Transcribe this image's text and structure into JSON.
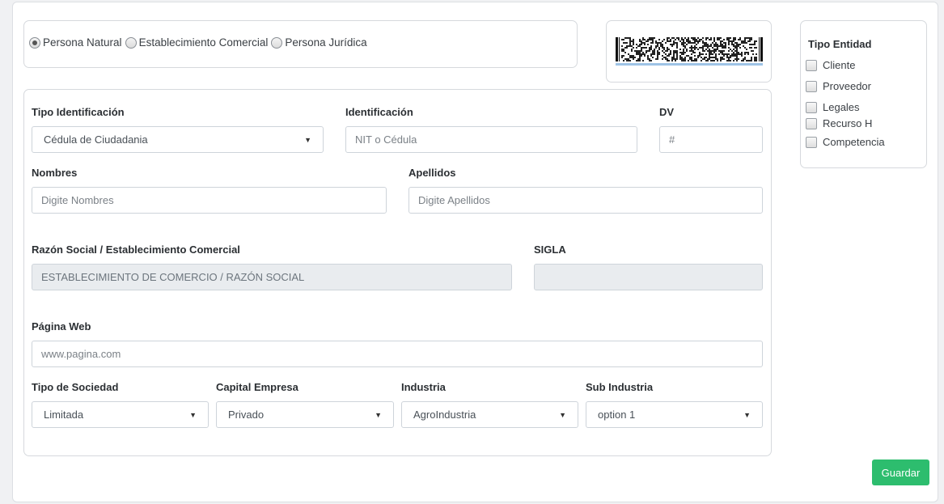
{
  "person_type": {
    "options": [
      {
        "label": "Persona Natural",
        "selected": true
      },
      {
        "label": "Establecimiento Comercial",
        "selected": false
      },
      {
        "label": "Persona Jurídica",
        "selected": false
      }
    ]
  },
  "form": {
    "tipo_identificacion": {
      "label": "Tipo Identificación",
      "value": "Cédula de Ciudadania"
    },
    "identificacion": {
      "label": "Identificación",
      "placeholder": "NIT o Cédula"
    },
    "dv": {
      "label": "DV",
      "placeholder": "#"
    },
    "nombres": {
      "label": "Nombres",
      "placeholder": "Digite Nombres"
    },
    "apellidos": {
      "label": "Apellidos",
      "placeholder": "Digite Apellidos"
    },
    "razon_social": {
      "label": "Razón Social / Establecimiento Comercial",
      "placeholder": "ESTABLECIMIENTO DE COMERCIO / RAZÓN SOCIAL"
    },
    "sigla": {
      "label": "SIGLA",
      "placeholder": ""
    },
    "pagina_web": {
      "label": "Página Web",
      "placeholder": "www.pagina.com"
    },
    "tipo_sociedad": {
      "label": "Tipo de Sociedad",
      "value": "Limitada"
    },
    "capital_empresa": {
      "label": "Capital Empresa",
      "value": "Privado"
    },
    "industria": {
      "label": "Industria",
      "value": "AgroIndustria"
    },
    "sub_industria": {
      "label": "Sub Industria",
      "value": "option 1"
    }
  },
  "tipo_entidad": {
    "title": "Tipo Entidad",
    "items": [
      {
        "label": "Cliente",
        "checked": false
      },
      {
        "label": "Proveedor",
        "checked": false
      },
      {
        "label": "Legales",
        "checked": false
      },
      {
        "label": "Recurso H",
        "checked": false
      },
      {
        "label": "Competencia",
        "checked": false
      }
    ]
  },
  "actions": {
    "save_label": "Guardar"
  },
  "colors": {
    "save_button": "#2dbd6e",
    "disabled_field": "#e9ecef",
    "border": "#ced4da"
  }
}
